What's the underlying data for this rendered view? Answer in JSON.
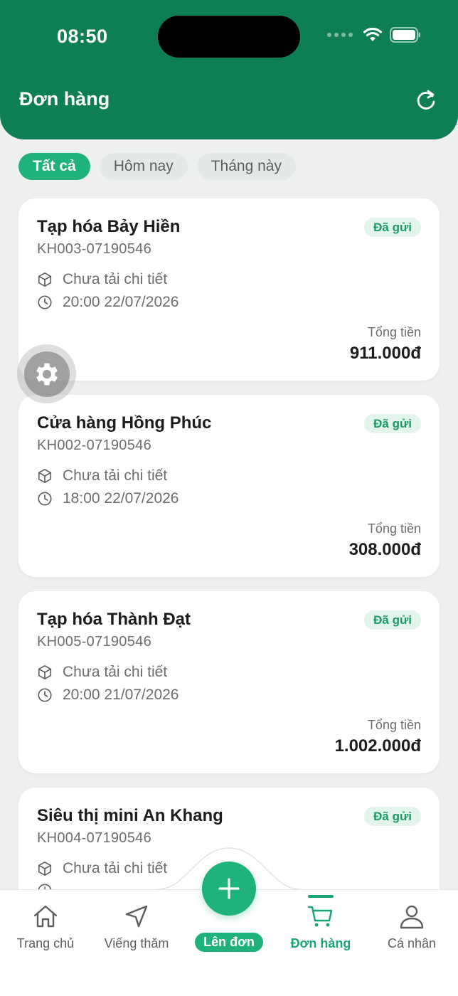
{
  "status_bar": {
    "time": "08:50"
  },
  "header": {
    "title": "Đơn hàng",
    "refresh_icon": "refresh-icon"
  },
  "filters": [
    {
      "label": "Tất cả",
      "active": true
    },
    {
      "label": "Hôm nay",
      "active": false
    },
    {
      "label": "Tháng này",
      "active": false
    }
  ],
  "orders": [
    {
      "name": "Tạp hóa Bảy Hiền",
      "code": "KH003-07190546",
      "status": "Đã gửi",
      "detail": "Chưa tải chi tiết",
      "datetime": "20:00 22/07/2026",
      "total_label": "Tổng tiền",
      "total": "911.000đ"
    },
    {
      "name": "Cửa hàng Hồng Phúc",
      "code": "KH002-07190546",
      "status": "Đã gửi",
      "detail": "Chưa tải chi tiết",
      "datetime": "18:00 22/07/2026",
      "total_label": "Tổng tiền",
      "total": "308.000đ"
    },
    {
      "name": "Tạp hóa Thành Đạt",
      "code": "KH005-07190546",
      "status": "Đã gửi",
      "detail": "Chưa tải chi tiết",
      "datetime": "20:00 21/07/2026",
      "total_label": "Tổng tiền",
      "total": "1.002.000đ"
    },
    {
      "name": "Siêu thị mini An Khang",
      "code": "KH004-07190546",
      "status": "Đã gửi",
      "detail": "Chưa tải chi tiết",
      "datetime": "",
      "total_label": "",
      "total": ""
    }
  ],
  "tabbar": {
    "items": [
      {
        "label": "Trang chủ",
        "icon": "home-icon"
      },
      {
        "label": "Viếng thăm",
        "icon": "navigation-icon"
      },
      {
        "label": "Lên đơn",
        "icon": "plus-icon"
      },
      {
        "label": "Đơn hàng",
        "icon": "cart-icon",
        "active": true
      },
      {
        "label": "Cá nhân",
        "icon": "user-icon"
      }
    ]
  },
  "colors": {
    "primary": "#0e7f55",
    "accent": "#1fb27b",
    "badge_bg": "#e3f4ec",
    "badge_text": "#1a9a67"
  }
}
